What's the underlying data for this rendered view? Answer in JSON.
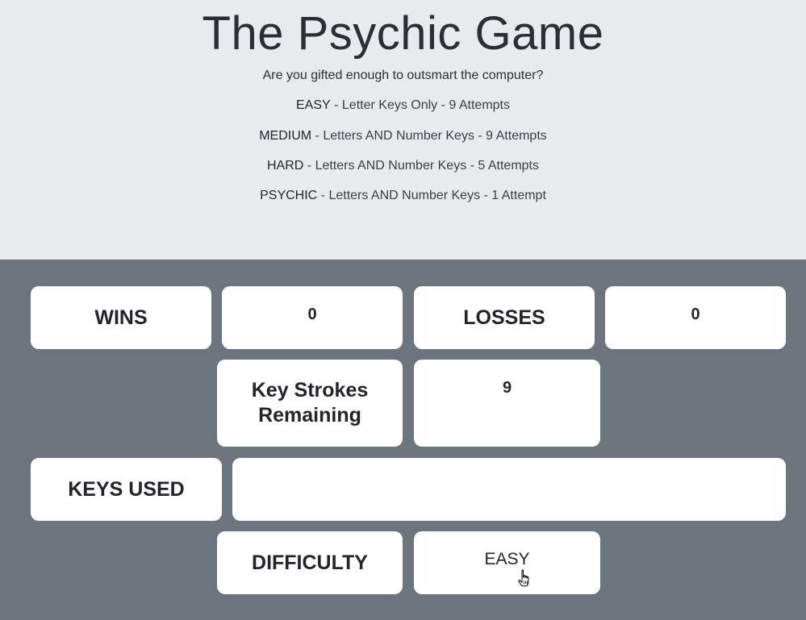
{
  "header": {
    "title": "The Psychic Game",
    "subtitle": "Are you gifted enough to outsmart the computer?",
    "difficulties": [
      {
        "level": "EASY",
        "desc": " - Letter Keys Only - 9 Attempts"
      },
      {
        "level": "MEDIUM",
        "desc": " - Letters AND Number Keys - 9 Attempts"
      },
      {
        "level": "HARD",
        "desc": " - Letters AND Number Keys - 5 Attempts"
      },
      {
        "level": "PSYCHIC",
        "desc": " - Letters AND Number Keys - 1 Attempt"
      }
    ]
  },
  "scoreboard": {
    "wins_label": "WINS",
    "wins_value": "0",
    "losses_label": "LOSSES",
    "losses_value": "0",
    "keystrokes_label": "Key Strokes Remaining",
    "keystrokes_value": "9",
    "keys_used_label": "KEYS USED",
    "keys_used_value": "",
    "difficulty_label": "DIFFICULTY",
    "difficulty_value": "EASY"
  },
  "colors": {
    "header_bg": "#e8ebee",
    "board_bg": "#6c757d",
    "tile_bg": "#ffffff"
  },
  "icons": {
    "cursor": "hand-pointer-icon"
  }
}
